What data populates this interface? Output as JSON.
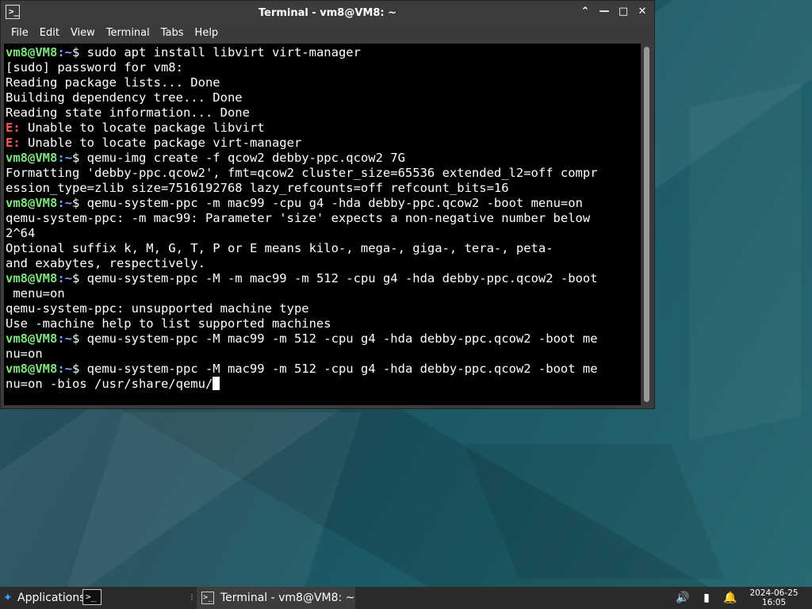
{
  "window": {
    "title": "Terminal - vm8@VM8: ~",
    "buttons": {
      "shade": "⌃",
      "minimize": "—",
      "maximize": "□",
      "close": "✕"
    }
  },
  "menubar": {
    "items": [
      "File",
      "Edit",
      "View",
      "Terminal",
      "Tabs",
      "Help"
    ]
  },
  "terminal": {
    "prompt_user": "vm8@VM8",
    "prompt_dir": ":~",
    "prompt_sym": "$ ",
    "lines": [
      {
        "type": "cmd",
        "text": "sudo apt install libvirt virt-manager"
      },
      {
        "type": "out",
        "text": "[sudo] password for vm8:"
      },
      {
        "type": "out",
        "text": "Reading package lists... Done"
      },
      {
        "type": "out",
        "text": "Building dependency tree... Done"
      },
      {
        "type": "out",
        "text": "Reading state information... Done"
      },
      {
        "type": "err",
        "label": "E:",
        "text": " Unable to locate package libvirt"
      },
      {
        "type": "err",
        "label": "E:",
        "text": " Unable to locate package virt-manager"
      },
      {
        "type": "cmd",
        "text": "qemu-img create -f qcow2 debby-ppc.qcow2 7G"
      },
      {
        "type": "out",
        "text": "Formatting 'debby-ppc.qcow2', fmt=qcow2 cluster_size=65536 extended_l2=off compr"
      },
      {
        "type": "out",
        "text": "ession_type=zlib size=7516192768 lazy_refcounts=off refcount_bits=16"
      },
      {
        "type": "cmd",
        "text": "qemu-system-ppc -m mac99 -cpu g4 -hda debby-ppc.qcow2 -boot menu=on"
      },
      {
        "type": "out",
        "text": "qemu-system-ppc: -m mac99: Parameter 'size' expects a non-negative number below"
      },
      {
        "type": "out",
        "text": "2^64"
      },
      {
        "type": "out",
        "text": "Optional suffix k, M, G, T, P or E means kilo-, mega-, giga-, tera-, peta-"
      },
      {
        "type": "out",
        "text": "and exabytes, respectively."
      },
      {
        "type": "cmd",
        "text": "qemu-system-ppc -M -m mac99 -m 512 -cpu g4 -hda debby-ppc.qcow2 -boot"
      },
      {
        "type": "out",
        "text": " menu=on"
      },
      {
        "type": "out",
        "text": "qemu-system-ppc: unsupported machine type"
      },
      {
        "type": "out",
        "text": "Use -machine help to list supported machines"
      },
      {
        "type": "cmd",
        "text": "qemu-system-ppc -M mac99 -m 512 -cpu g4 -hda debby-ppc.qcow2 -boot me"
      },
      {
        "type": "out",
        "text": "nu=on"
      },
      {
        "type": "cmd",
        "text": "qemu-system-ppc -M mac99 -m 512 -cpu g4 -hda debby-ppc.qcow2 -boot me"
      },
      {
        "type": "cursor",
        "text": "nu=on -bios /usr/share/qemu/"
      }
    ]
  },
  "taskbar": {
    "applications_label": "Applications",
    "applications_icon": "applications-menu-icon",
    "launcher_icon": "terminal-icon",
    "task_label": "Terminal - vm8@VM8: ~",
    "separator": "⁝",
    "tray_icons": [
      "volume-icon",
      "battery-icon",
      "notification-bell-icon"
    ],
    "tray_glyphs": [
      "🔊",
      "▮",
      "🔔"
    ],
    "date": "2024-06-25",
    "time": "16:05"
  }
}
